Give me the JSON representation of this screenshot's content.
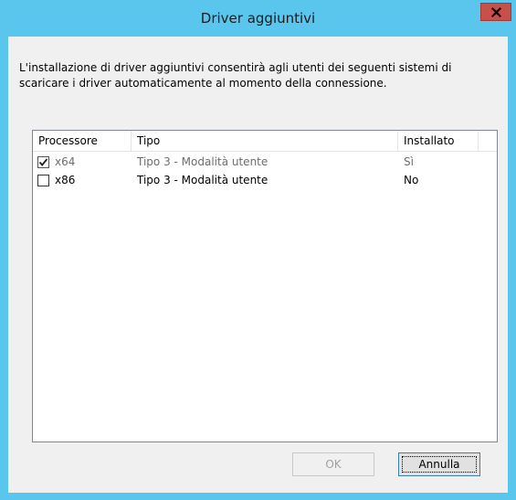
{
  "window": {
    "title": "Driver aggiuntivi"
  },
  "description": "L'installazione di driver aggiuntivi consentirà agli utenti dei seguenti sistemi di scaricare i driver automaticamente al momento della connessione.",
  "list": {
    "columns": [
      "Processore",
      "Tipo",
      "Installato"
    ],
    "rows": [
      {
        "checked": true,
        "disabled": true,
        "processor": "x64",
        "type": "Tipo 3 - Modalità utente",
        "installed": "Sì"
      },
      {
        "checked": false,
        "disabled": false,
        "processor": "x86",
        "type": "Tipo 3 - Modalità utente",
        "installed": "No"
      }
    ]
  },
  "buttons": {
    "ok": "OK",
    "cancel": "Annulla"
  },
  "colors": {
    "titlebar": "#5ac6ee",
    "close": "#c7504b",
    "dialog": "#f0f0f0"
  },
  "icons": {
    "close": "close-icon",
    "check": "checkmark-icon"
  }
}
